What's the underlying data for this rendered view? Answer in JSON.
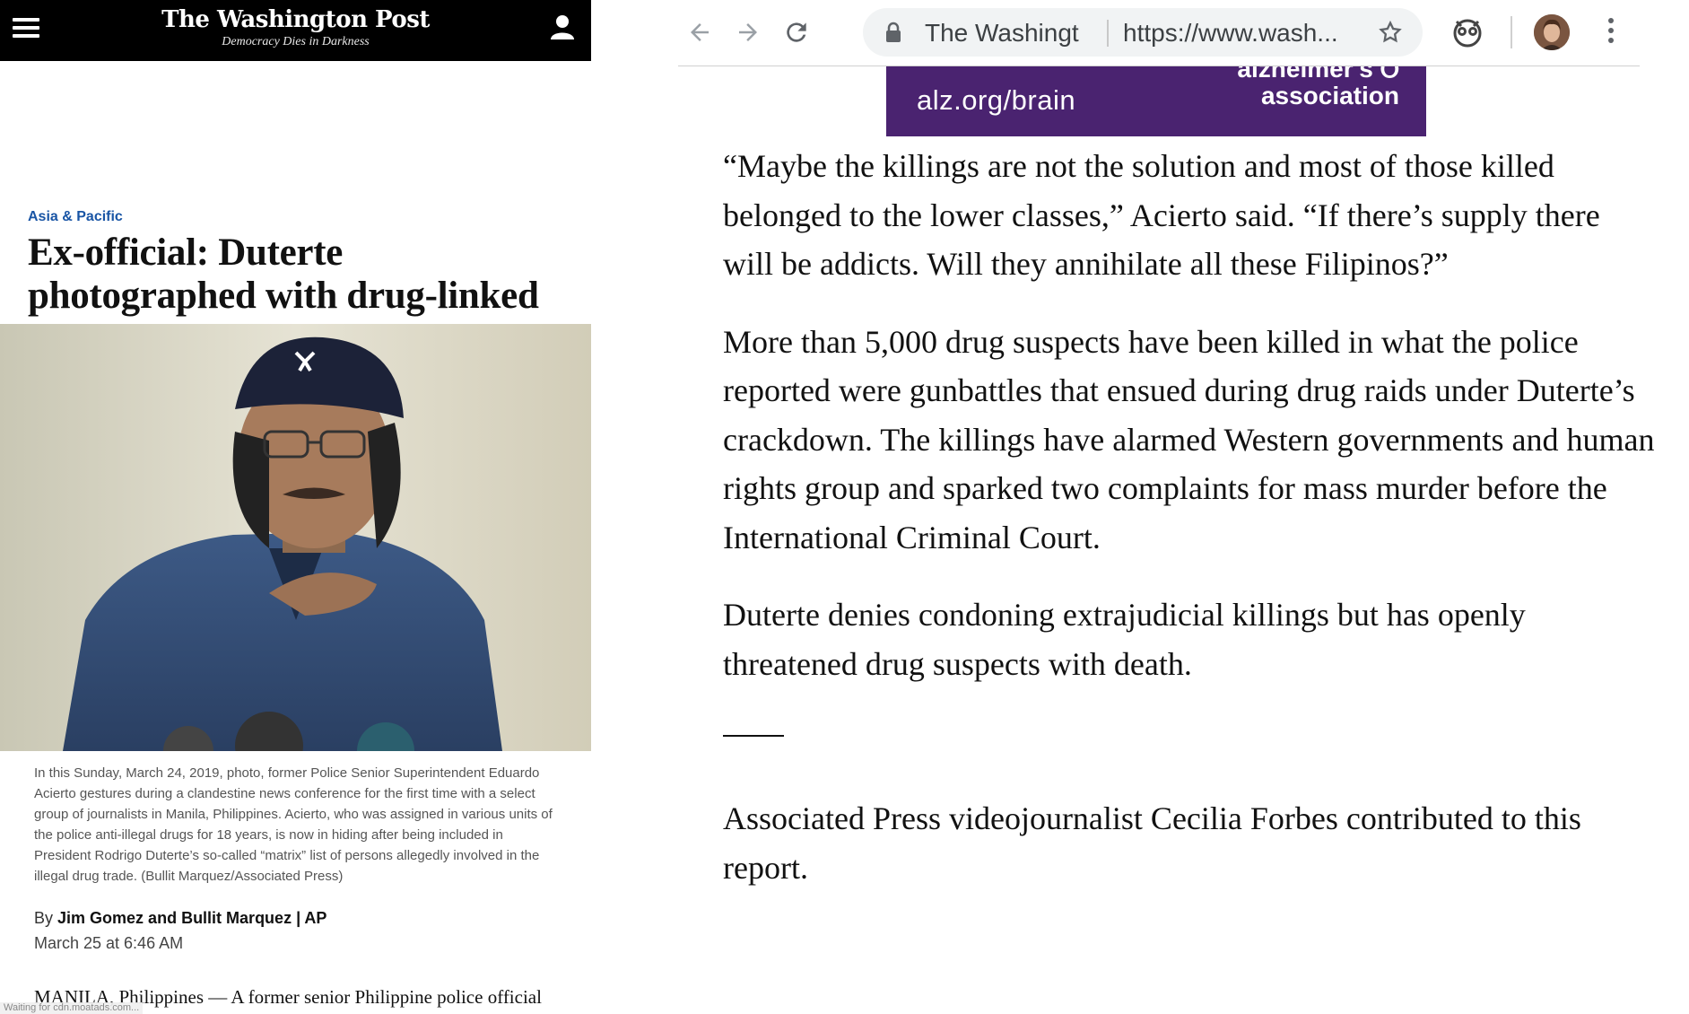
{
  "left_panel": {
    "header": {
      "masthead": "The Washington Post",
      "tagline": "Democracy Dies in Darkness"
    },
    "section": "Asia & Pacific",
    "headline": "Ex-official: Duterte photographed with drug-linked Chinese",
    "photo_caption": "In this Sunday, March 24, 2019, photo, former Police Senior Superintendent Eduardo Acierto gestures during a clandestine news conference for the first time with a select group of journalists in Manila, Philippines. Acierto, who was assigned in various units of the police anti-illegal drugs for 18 years, is now in hiding after being included in President Rodrigo Duterte’s so-called “matrix” list of persons allegedly involved in the illegal drug trade. (Bullit Marquez/Associated Press)",
    "byline_prefix": "By",
    "byline_authors": "Jim Gomez and Bullit Marquez | AP",
    "date": "March 25 at 6:46 AM",
    "lede": "MANILA, Philippines — A former senior Philippine police official said President Rodrigo Duterte, who has faced",
    "status_text": "Waiting for cdn.moatads.com..."
  },
  "browser": {
    "tab_title": "The Washingt",
    "url": "https://www.wash...",
    "icons": [
      "back-arrow-icon",
      "forward-arrow-icon",
      "reload-icon",
      "lock-icon",
      "star-icon",
      "extension-icon",
      "profile-avatar",
      "more-vert-icon"
    ]
  },
  "ad": {
    "url_text": "alz.org/brain",
    "logo_line1": "alzheimer's ℧",
    "logo_line2": "association"
  },
  "article": {
    "paragraphs": [
      "“Maybe the killings are not the solution and most of those killed belonged to the lower classes,” Acierto said. “If there’s supply there will be addicts. Will they annihilate all these Filipinos?”",
      "More than 5,000 drug suspects have been killed in what the police reported were gunbattles that ensued during drug raids under Duterte’s crackdown. The killings have alarmed Western governments and human rights group and sparked two complaints for mass murder before the International Criminal Court.",
      "Duterte denies condoning extrajudicial killings but has openly threatened drug suspects with death."
    ],
    "credit": "Associated Press videojournalist Cecilia Forbes contributed to this report."
  },
  "colors": {
    "section_blue": "#1955a5",
    "ad_purple": "#4a2370",
    "header_black": "#000000"
  }
}
